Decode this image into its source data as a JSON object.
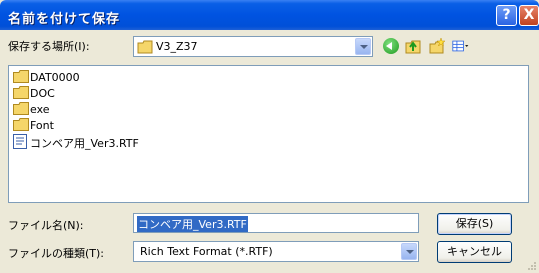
{
  "window": {
    "title": "名前を付けて保存",
    "help_glyph": "?",
    "close_glyph": "X"
  },
  "location": {
    "label": "保存する場所(I):",
    "current_folder": "V3_Z37"
  },
  "toolbar": {
    "icons": [
      "back-icon",
      "up-folder-icon",
      "new-folder-icon",
      "views-menu-icon"
    ]
  },
  "files": [
    {
      "name": "DAT0000",
      "type": "folder"
    },
    {
      "name": "DOC",
      "type": "folder"
    },
    {
      "name": "exe",
      "type": "folder"
    },
    {
      "name": "Font",
      "type": "folder"
    },
    {
      "name": "コンベア用_Ver3.RTF",
      "type": "rtf-document"
    }
  ],
  "filename": {
    "label": "ファイル名(N):",
    "value": "コンベア用_Ver3.RTF"
  },
  "filetype": {
    "label": "ファイルの種類(T):",
    "selected": "Rich Text Format (*.RTF)"
  },
  "buttons": {
    "save": "保存(S)",
    "cancel": "キャンセル"
  },
  "colors": {
    "titlebar": "#0053e1",
    "dialog_bg": "#ece9d8",
    "selection": "#316ac5",
    "folder": "#f5d66a"
  }
}
